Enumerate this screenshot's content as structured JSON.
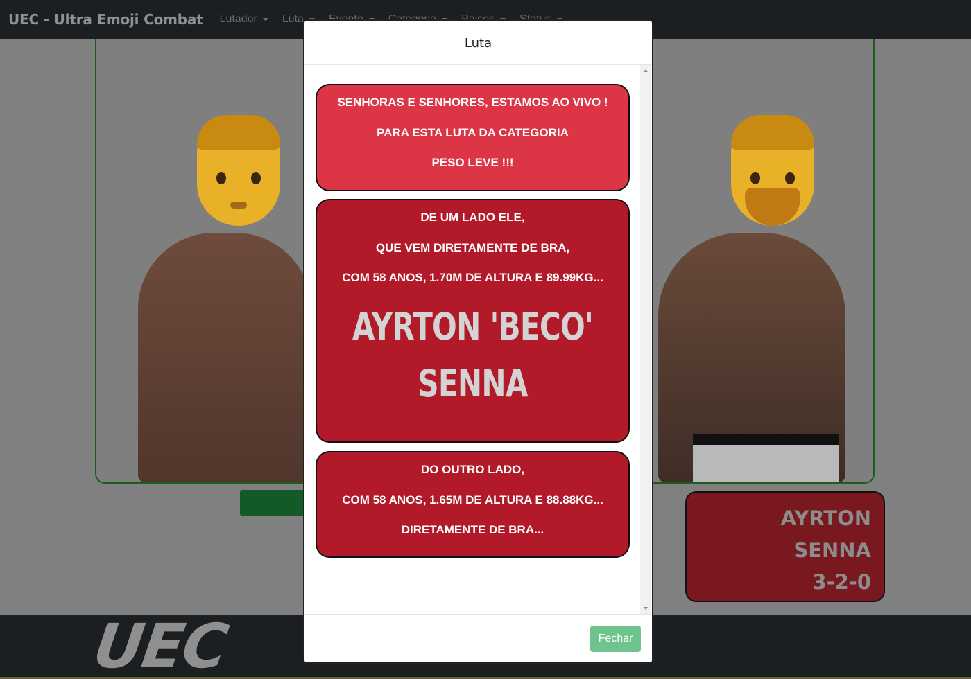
{
  "navbar": {
    "brand": "UEC - Ultra Emoji Combat",
    "menu": [
      "Lutador",
      "Luta",
      "Evento",
      "Categoria",
      "Paises",
      "Status"
    ]
  },
  "record_card": {
    "line1": "AYRTON",
    "line2": "SENNA",
    "record": "3-2-0"
  },
  "footer": {
    "logo": "UEC"
  },
  "modal": {
    "title": "Luta",
    "intro": [
      "SENHORAS E SENHORES, ESTAMOS AO VIVO !",
      "PARA ESTA LUTA DA CATEGORIA",
      "PESO LEVE !!!"
    ],
    "fighter1": {
      "lines": [
        "DE UM LADO ELE,",
        "QUE VEM DIRETAMENTE DE BRA,",
        "COM 58 ANOS, 1.70M DE ALTURA E 89.99KG..."
      ],
      "name_line1": "AYRTON 'BECO'",
      "name_line2": "SENNA"
    },
    "fighter2": {
      "lines": [
        "DO OUTRO LADO,",
        "COM 58 ANOS, 1.65M DE ALTURA E 88.88KG...",
        "DIRETAMENTE DE BRA..."
      ]
    },
    "close_label": "Fechar"
  },
  "colors": {
    "navbar": "#1b1f22",
    "intro_box": "#dc3545",
    "fighter_box": "#b21a2a",
    "close_button": "#6fc38c"
  }
}
